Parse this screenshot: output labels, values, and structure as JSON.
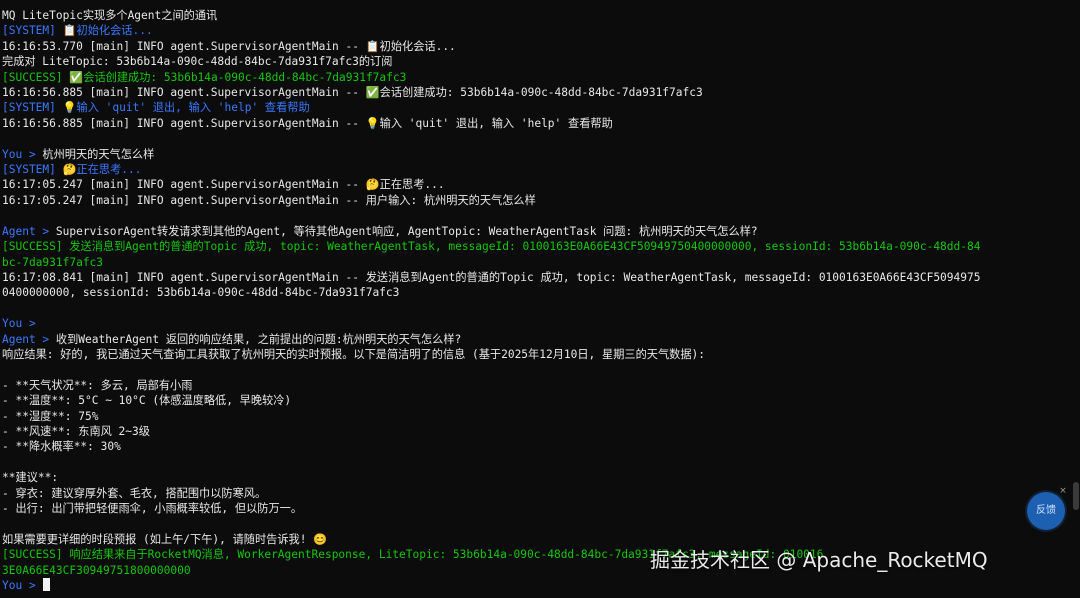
{
  "terminal": {
    "lines": [
      {
        "kind": "default",
        "text": "MQ LiteTopic实现多个Agent之间的通讯"
      },
      {
        "kind": "system",
        "text": "[SYSTEM] 📋初始化会话..."
      },
      {
        "kind": "default",
        "text": "16:16:53.770 [main] INFO agent.SupervisorAgentMain -- 📋初始化会话..."
      },
      {
        "kind": "default",
        "text": "完成对 LiteTopic: 53b6b14a-090c-48dd-84bc-7da931f7afc3的订阅"
      },
      {
        "kind": "success",
        "text": "[SUCCESS] ✅会话创建成功: 53b6b14a-090c-48dd-84bc-7da931f7afc3"
      },
      {
        "kind": "default",
        "text": "16:16:56.885 [main] INFO agent.SupervisorAgentMain -- ✅会话创建成功: 53b6b14a-090c-48dd-84bc-7da931f7afc3"
      },
      {
        "kind": "system",
        "text": "[SYSTEM] 💡输入 'quit' 退出, 输入 'help' 查看帮助"
      },
      {
        "kind": "default",
        "text": "16:16:56.885 [main] INFO agent.SupervisorAgentMain -- 💡输入 'quit' 退出, 输入 'help' 查看帮助"
      },
      {
        "kind": "default",
        "text": ""
      },
      {
        "kind": "prompt",
        "label": "You > ",
        "text": "杭州明天的天气怎么样"
      },
      {
        "kind": "system",
        "text": "[SYSTEM] 🤔正在思考..."
      },
      {
        "kind": "default",
        "text": "16:17:05.247 [main] INFO agent.SupervisorAgentMain -- 🤔正在思考..."
      },
      {
        "kind": "default",
        "text": "16:17:05.247 [main] INFO agent.SupervisorAgentMain -- 用户输入: 杭州明天的天气怎么样"
      },
      {
        "kind": "default",
        "text": ""
      },
      {
        "kind": "prompt",
        "label": "Agent > ",
        "text": "SupervisorAgent转发请求到其他的Agent, 等待其他Agent响应, AgentTopic: WeatherAgentTask 问题: 杭州明天的天气怎么样?"
      },
      {
        "kind": "success",
        "text": "[SUCCESS] 发送消息到Agent的普通的Topic 成功, topic: WeatherAgentTask, messageId: 0100163E0A66E43CF50949750400000000, sessionId: 53b6b14a-090c-48dd-84"
      },
      {
        "kind": "success",
        "text": "bc-7da931f7afc3"
      },
      {
        "kind": "default",
        "text": "16:17:08.841 [main] INFO agent.SupervisorAgentMain -- 发送消息到Agent的普通的Topic 成功, topic: WeatherAgentTask, messageId: 0100163E0A66E43CF5094975"
      },
      {
        "kind": "default",
        "text": "0400000000, sessionId: 53b6b14a-090c-48dd-84bc-7da931f7afc3"
      },
      {
        "kind": "default",
        "text": ""
      },
      {
        "kind": "prompt",
        "label": "You > ",
        "text": ""
      },
      {
        "kind": "prompt",
        "label": "Agent > ",
        "text": "收到WeatherAgent 返回的响应结果, 之前提出的问题:杭州明天的天气怎么样?"
      },
      {
        "kind": "default",
        "text": "响应结果: 好的, 我已通过天气查询工具获取了杭州明天的实时预报。以下是简洁明了的信息 (基于2025年12月10日, 星期三的天气数据):"
      },
      {
        "kind": "default",
        "text": ""
      },
      {
        "kind": "default",
        "text": "- **天气状况**: 多云, 局部有小雨"
      },
      {
        "kind": "default",
        "text": "- **温度**: 5°C ~ 10°C (体感温度略低, 早晚较冷)"
      },
      {
        "kind": "default",
        "text": "- **湿度**: 75%"
      },
      {
        "kind": "default",
        "text": "- **风速**: 东南风 2~3级"
      },
      {
        "kind": "default",
        "text": "- **降水概率**: 30%"
      },
      {
        "kind": "default",
        "text": ""
      },
      {
        "kind": "default",
        "text": "**建议**:"
      },
      {
        "kind": "default",
        "text": "- 穿衣: 建议穿厚外套、毛衣, 搭配围巾以防寒风。"
      },
      {
        "kind": "default",
        "text": "- 出行: 出门带把轻便雨伞, 小雨概率较低, 但以防万一。"
      },
      {
        "kind": "default",
        "text": ""
      },
      {
        "kind": "default",
        "text": "如果需要更详细的时段预报 (如上午/下午), 请随时告诉我! 😊"
      },
      {
        "kind": "success",
        "text": "[SUCCESS] 响应结果来自于RocketMQ消息, WorkerAgentResponse, LiteTopic: 53b6b14a-090c-48dd-84bc-7da931f7afc3, messageId: 010016"
      },
      {
        "kind": "success",
        "text": "3E0A66E43CF30949751800000000"
      },
      {
        "kind": "prompt",
        "label": "You > ",
        "text": "",
        "cursor": true
      }
    ]
  },
  "float_button": {
    "label": "反馈",
    "close": "×"
  },
  "watermark": "掘金技术社区 @ Apache_RocketMQ",
  "colors": {
    "background": "#0c0c0c",
    "default": "#e8e8e8",
    "system": "#3b78ff",
    "success": "#16c60c",
    "prompt": "#3b78ff"
  }
}
